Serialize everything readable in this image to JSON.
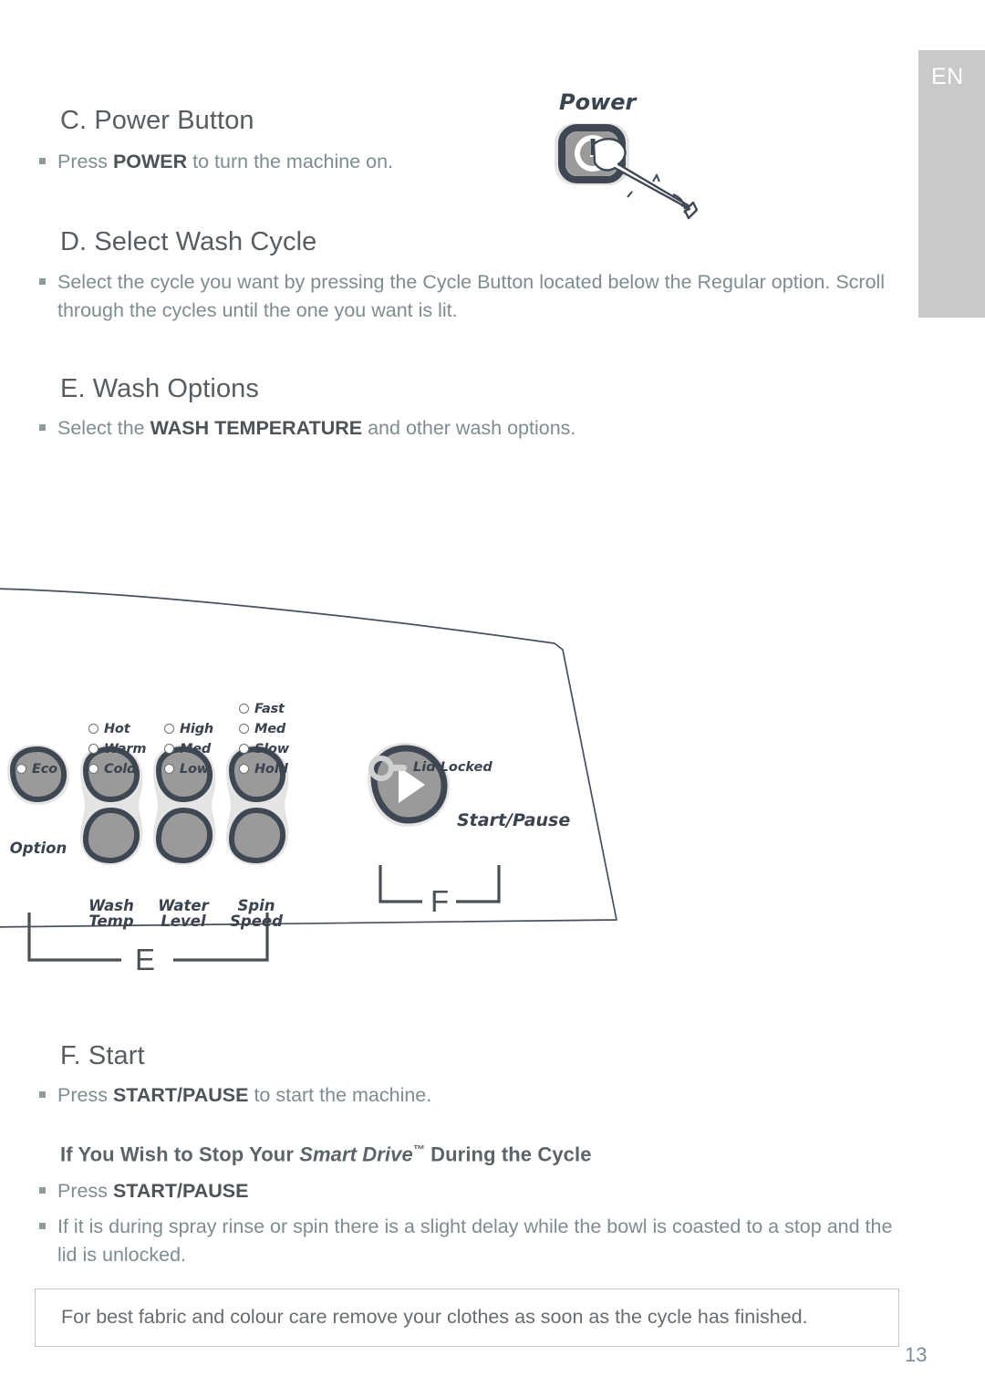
{
  "lang_tab": {
    "label": "EN"
  },
  "page_number": "13",
  "sections": [
    {
      "id": "power-button",
      "heading": "C. Power Button",
      "bullets": [
        {
          "pre": "Press ",
          "strong": "POWER",
          "post": " to turn the machine on."
        }
      ]
    },
    {
      "id": "select-wash-cycle",
      "heading": "D. Select Wash Cycle",
      "bullets": [
        {
          "pre": "Select the cycle you want by pressing the Cycle Button located below the Regular option. Scroll through the cycles until the one you want is lit.",
          "strong": "",
          "post": ""
        }
      ]
    },
    {
      "id": "wash-options",
      "heading": "E. Wash Options",
      "bullets": [
        {
          "pre": "Select the ",
          "strong": "WASH TEMPERATURE",
          "post": " and other wash options."
        }
      ]
    },
    {
      "id": "start",
      "heading": "F. Start",
      "bullets": [
        {
          "pre": "Press ",
          "strong": "START/PAUSE",
          "post": " to start the machine."
        }
      ]
    }
  ],
  "stop_subsection": {
    "heading_part1": "If You Wish to Stop Your ",
    "heading_italic": "Smart Drive",
    "heading_tm": "™",
    "heading_part2": " During the Cycle",
    "bullet1_pre": "Press ",
    "bullet1_strong": "START/PAUSE",
    "bullet2": "If it is during spray rinse or spin there is a slight delay while the bowl is coasted to a stop and the lid is unlocked."
  },
  "note_box": {
    "text": "For best fabric and colour care remove your clothes as soon as the cycle has finished."
  },
  "power_illustration": {
    "label": "Power",
    "icon": "power-symbol-icon",
    "hand": "pointing-finger-icon"
  },
  "control_panel": {
    "option_button": {
      "label": "Option",
      "leds": [
        "Eco"
      ]
    },
    "wash_temp_button": {
      "label_line1": "Wash",
      "label_line2": "Temp",
      "leds": [
        "Hot",
        "Warm",
        "Cold"
      ]
    },
    "water_level_button": {
      "label_line1": "Water",
      "label_line2": "Level",
      "leds": [
        "High",
        "Med",
        "Low"
      ]
    },
    "spin_speed_button": {
      "label_line1": "Spin",
      "label_line2": "Speed",
      "leds": [
        "Fast",
        "Med",
        "Slow",
        "Hold"
      ]
    },
    "lid_locked": {
      "label": "Lid Locked"
    },
    "start_pause": {
      "label": "Start/Pause"
    },
    "marker_e": "E",
    "marker_f": "F"
  },
  "colors": {
    "heading": "#575d61",
    "body_text": "#7f8c8f",
    "body_strong": "#4d5356",
    "lang_tab_bg": "#c7c9cb",
    "panel_button_ring": "#3f4752",
    "panel_button_fill": "#9a9a9a",
    "panel_button_halo": "#e2e2e2",
    "panel_outline": "#474f5c",
    "note_border": "#c3c7cf"
  }
}
